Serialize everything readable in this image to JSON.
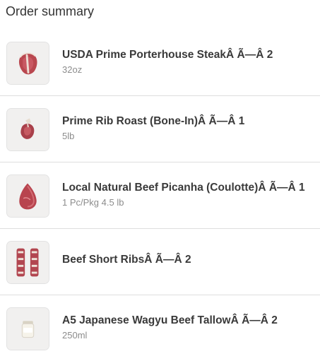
{
  "summary": {
    "title": "Order summary",
    "items": [
      {
        "name": "USDA Prime Porterhouse SteakÂ Ã—Â 2",
        "variant": "32oz",
        "thumbnail": "porterhouse-steak-image"
      },
      {
        "name": "Prime Rib Roast (Bone-In)Â Ã—Â 1",
        "variant": "5lb",
        "thumbnail": "rib-roast-image"
      },
      {
        "name": "Local Natural Beef Picanha (Coulotte)Â Ã—Â 1",
        "variant": "1 Pc/Pkg 4.5 lb",
        "thumbnail": "picanha-image"
      },
      {
        "name": "Beef Short RibsÂ Ã—Â 2",
        "variant": "",
        "thumbnail": "short-ribs-image"
      },
      {
        "name": "A5 Japanese Wagyu Beef TallowÂ Ã—Â 2",
        "variant": "250ml",
        "thumbnail": "tallow-jar-image"
      }
    ]
  }
}
